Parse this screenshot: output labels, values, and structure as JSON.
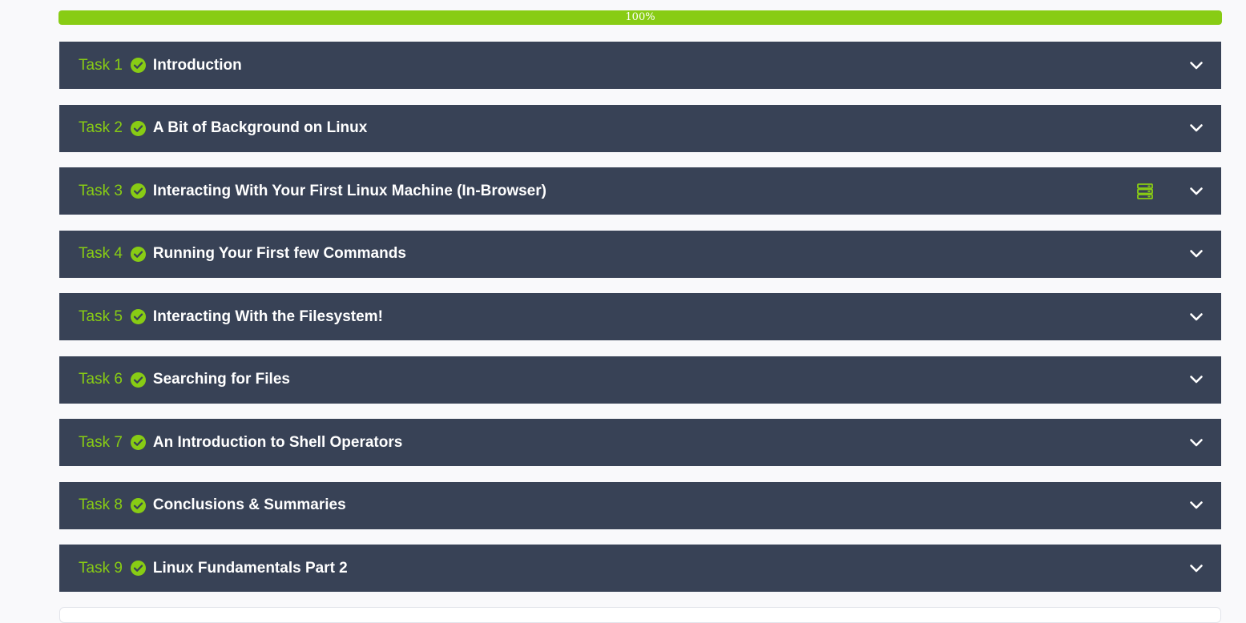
{
  "progress": {
    "label": "100%",
    "value": 1.0
  },
  "colors": {
    "accent": "#88cc14",
    "task_bg": "#384256",
    "page_bg": "#f9f9fb"
  },
  "tasks": [
    {
      "number": "Task 1",
      "title": "Introduction",
      "completed": true,
      "has_machine_icon": false
    },
    {
      "number": "Task 2",
      "title": "A Bit of Background on Linux",
      "completed": true,
      "has_machine_icon": false
    },
    {
      "number": "Task 3",
      "title": "Interacting With Your First Linux Machine (In-Browser)",
      "completed": true,
      "has_machine_icon": true
    },
    {
      "number": "Task 4",
      "title": "Running Your First few Commands",
      "completed": true,
      "has_machine_icon": false
    },
    {
      "number": "Task 5",
      "title": "Interacting With the Filesystem!",
      "completed": true,
      "has_machine_icon": false
    },
    {
      "number": "Task 6",
      "title": "Searching for Files",
      "completed": true,
      "has_machine_icon": false
    },
    {
      "number": "Task 7",
      "title": "An Introduction to Shell Operators",
      "completed": true,
      "has_machine_icon": false
    },
    {
      "number": "Task 8",
      "title": "Conclusions & Summaries",
      "completed": true,
      "has_machine_icon": false
    },
    {
      "number": "Task 9",
      "title": "Linux Fundamentals Part 2",
      "completed": true,
      "has_machine_icon": false
    }
  ],
  "icons": {
    "completed": "check-circle-icon",
    "machine": "server-icon",
    "expand": "chevron-down-icon"
  }
}
